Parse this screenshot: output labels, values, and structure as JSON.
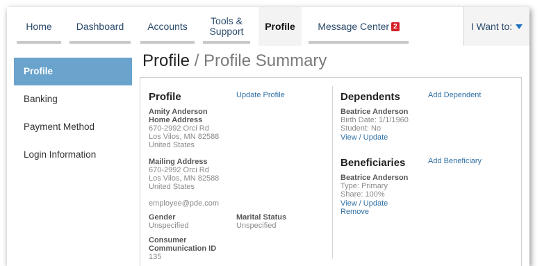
{
  "nav": {
    "items": [
      {
        "label": "Home"
      },
      {
        "label": "Dashboard"
      },
      {
        "label": "Accounts"
      },
      {
        "label": "Tools &\nSupport"
      },
      {
        "label": "Profile"
      },
      {
        "label": "Message Center"
      }
    ],
    "message_badge": "2",
    "iwant_label": "I Want to:"
  },
  "sidebar": {
    "items": [
      {
        "label": "Profile"
      },
      {
        "label": "Banking"
      },
      {
        "label": "Payment Method"
      },
      {
        "label": "Login Information"
      }
    ]
  },
  "page": {
    "title": "Profile",
    "separator": " / ",
    "subtitle": "Profile Summary"
  },
  "profile": {
    "heading": "Profile",
    "update_link": "Update Profile",
    "name": "Amity Anderson",
    "home_label": "Home Address",
    "home_line1": "670-2992 Orci Rd",
    "home_line2": "Los Vilos, MN 82588",
    "home_line3": "United States",
    "mailing_label": "Mailing Address",
    "mail_line1": "670-2992 Orci Rd",
    "mail_line2": "Los Vilos, MN 82588",
    "mail_line3": "United States",
    "email": "employee@pde.com",
    "gender_label": "Gender",
    "gender_value": "Unspecified",
    "marital_label": "Marital Status",
    "marital_value": "Unspecified",
    "comm_label_1": "Consumer",
    "comm_label_2": "Communication ID",
    "comm_value": "135"
  },
  "dependents": {
    "heading": "Dependents",
    "add_link": "Add Dependent",
    "name": "Beatrice Anderson",
    "birth": "Birth Date: 1/1/1960",
    "student": "Student: No",
    "view_link": "View / Update"
  },
  "beneficiaries": {
    "heading": "Beneficiaries",
    "add_link": "Add Beneficiary",
    "name": "Beatrice Anderson",
    "type": "Type: Primary",
    "share": "Share: 100%",
    "view_link": "View / Update",
    "remove_link": "Remove"
  },
  "colors": {
    "accent": "#6aa4cc",
    "link": "#2f6fa3",
    "badge": "#d6212a"
  }
}
